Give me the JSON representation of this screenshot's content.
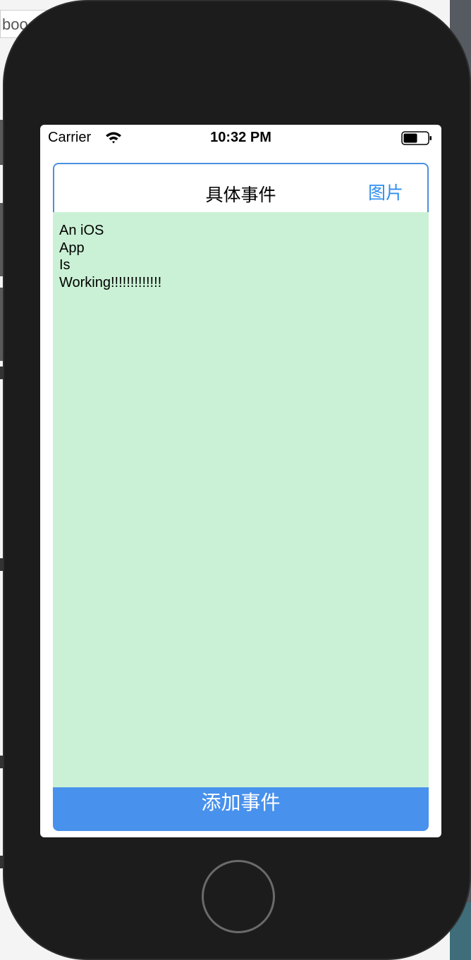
{
  "background": {
    "tab_fragment": "boo"
  },
  "status_bar": {
    "carrier": "Carrier",
    "time": "10:32 PM",
    "wifi_icon": "wifi-icon",
    "battery_icon": "battery-icon"
  },
  "nav": {
    "title": "具体事件",
    "right_button": "图片"
  },
  "content": {
    "text": "An iOS\nApp\nIs\nWorking!!!!!!!!!!!!!"
  },
  "add_button": {
    "label": "添加事件"
  },
  "colors": {
    "accent": "#4891ec",
    "link": "#2f8ef0",
    "content_background": "#caf1d5",
    "device_frame": "#1c1c1c"
  }
}
